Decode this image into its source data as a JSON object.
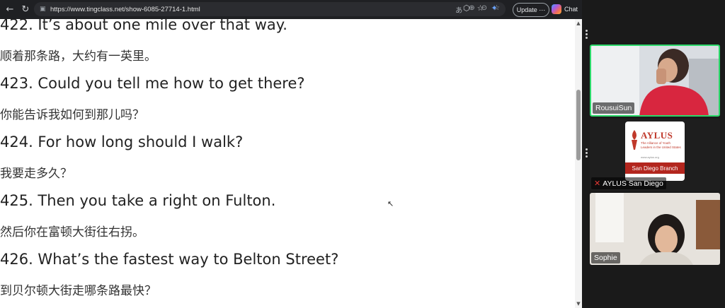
{
  "browser": {
    "url": "https://www.tingclass.net/show-6085-27714-1.html",
    "update_label": "Update",
    "update_more": "⋯",
    "chat_label": "Chat",
    "icons": [
      "back-icon",
      "refresh-icon",
      "lock-icon",
      "translate-icon",
      "zoom-icon",
      "more-icon",
      "favorite-icon",
      "extensions-icon",
      "collections-icon",
      "profile-icon"
    ]
  },
  "lines": [
    {
      "en": "422. It’s about one mile over that way.",
      "zh": "顺着那条路，大约有一英里。"
    },
    {
      "en": "423. Could you tell me how to get there?",
      "zh": "你能告诉我如何到那儿吗？"
    },
    {
      "en": "424. For how long should I walk?",
      "zh": "我要走多久？"
    },
    {
      "en": "425. Then you take a right on Fulton.",
      "zh": "然后你在富顿大街往右拐。"
    },
    {
      "en": "426. What’s the fastest way to Belton Street?",
      "zh": "到贝尔顿大街走哪条路最快？"
    }
  ],
  "participants": [
    {
      "name": "RousuiSun",
      "active": true,
      "muted": false
    },
    {
      "name": "AYLUS San Diego",
      "muted": true,
      "logo": {
        "title": "AYLUS",
        "subtitle": "The Alliance of Youth Leaders in the United States",
        "url": "www.aylus.org",
        "branch": "San Diego Branch"
      }
    },
    {
      "name": "Sophie",
      "muted": false
    }
  ],
  "colors": {
    "active_border": "#2bd96a",
    "logo_red": "#b3261e",
    "toolbar": "#1f2023"
  }
}
